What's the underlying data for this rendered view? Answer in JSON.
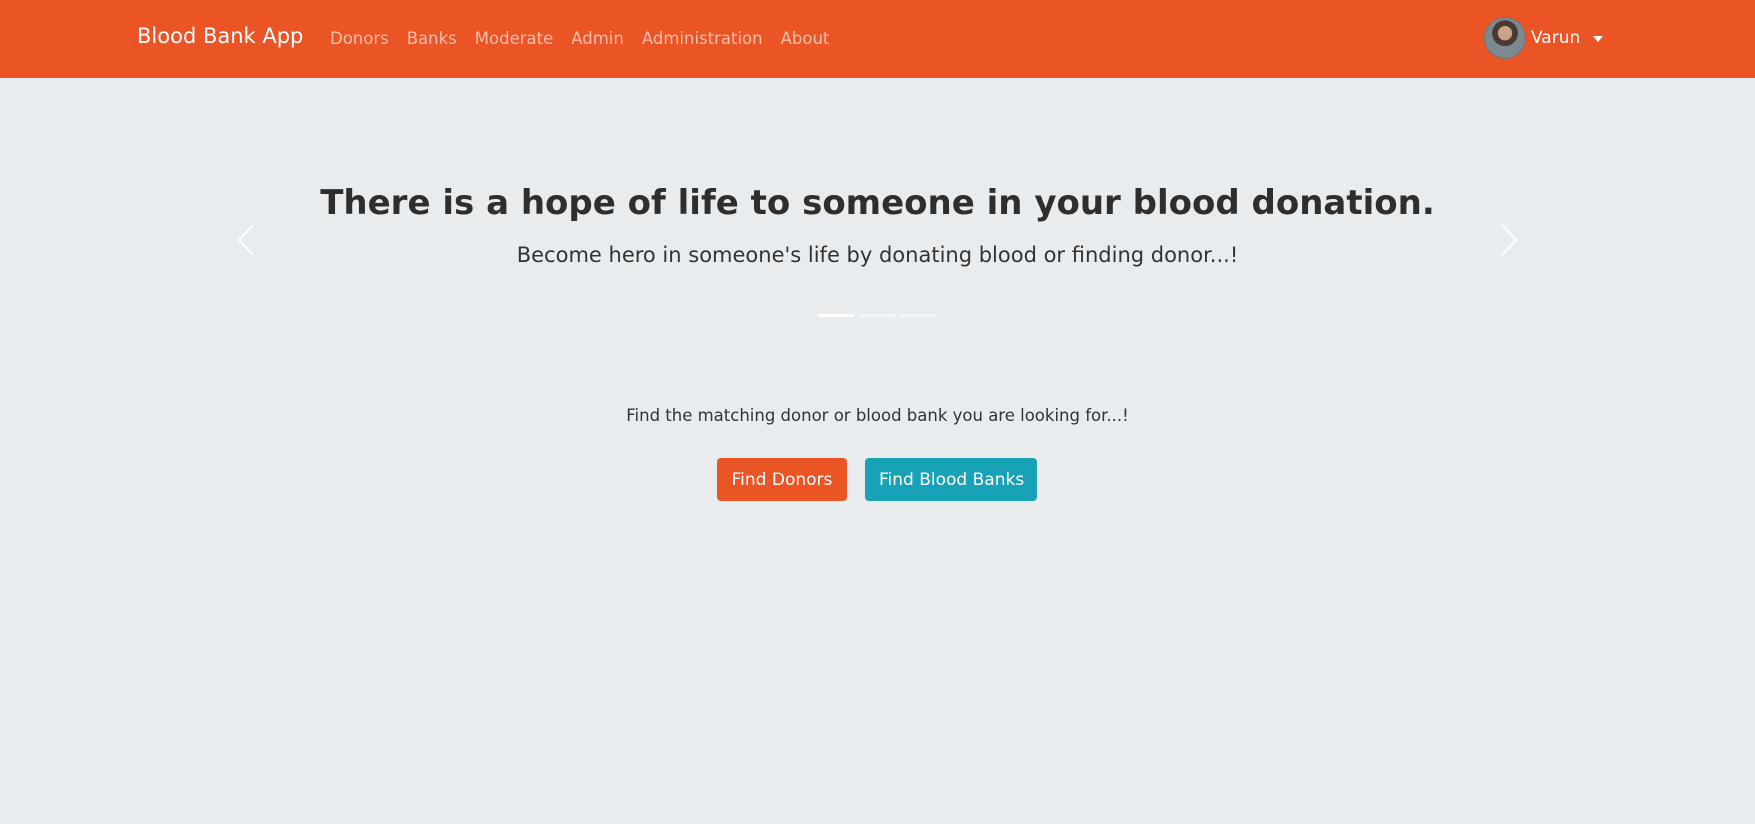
{
  "navbar": {
    "brand": "Blood Bank App",
    "links": [
      "Donors",
      "Banks",
      "Moderate",
      "Admin",
      "Administration",
      "About"
    ],
    "user_name": "Varun",
    "color": "#eb5424"
  },
  "carousel": {
    "title": "There is a hope of life to someone in your blood donation.",
    "subtitle": "Become hero in someone's life by donating blood or finding donor...!",
    "slide_count": 3,
    "active_slide": 1
  },
  "cta": {
    "text": "Find the matching donor or blood bank you are looking for...!",
    "find_donors_label": "Find Donors",
    "find_banks_label": "Find Blood Banks",
    "colors": {
      "donors": "#eb5424",
      "banks": "#17a2b8"
    }
  },
  "icons": [
    "chevron-left-icon",
    "chevron-right-icon",
    "caret-down-icon"
  ]
}
